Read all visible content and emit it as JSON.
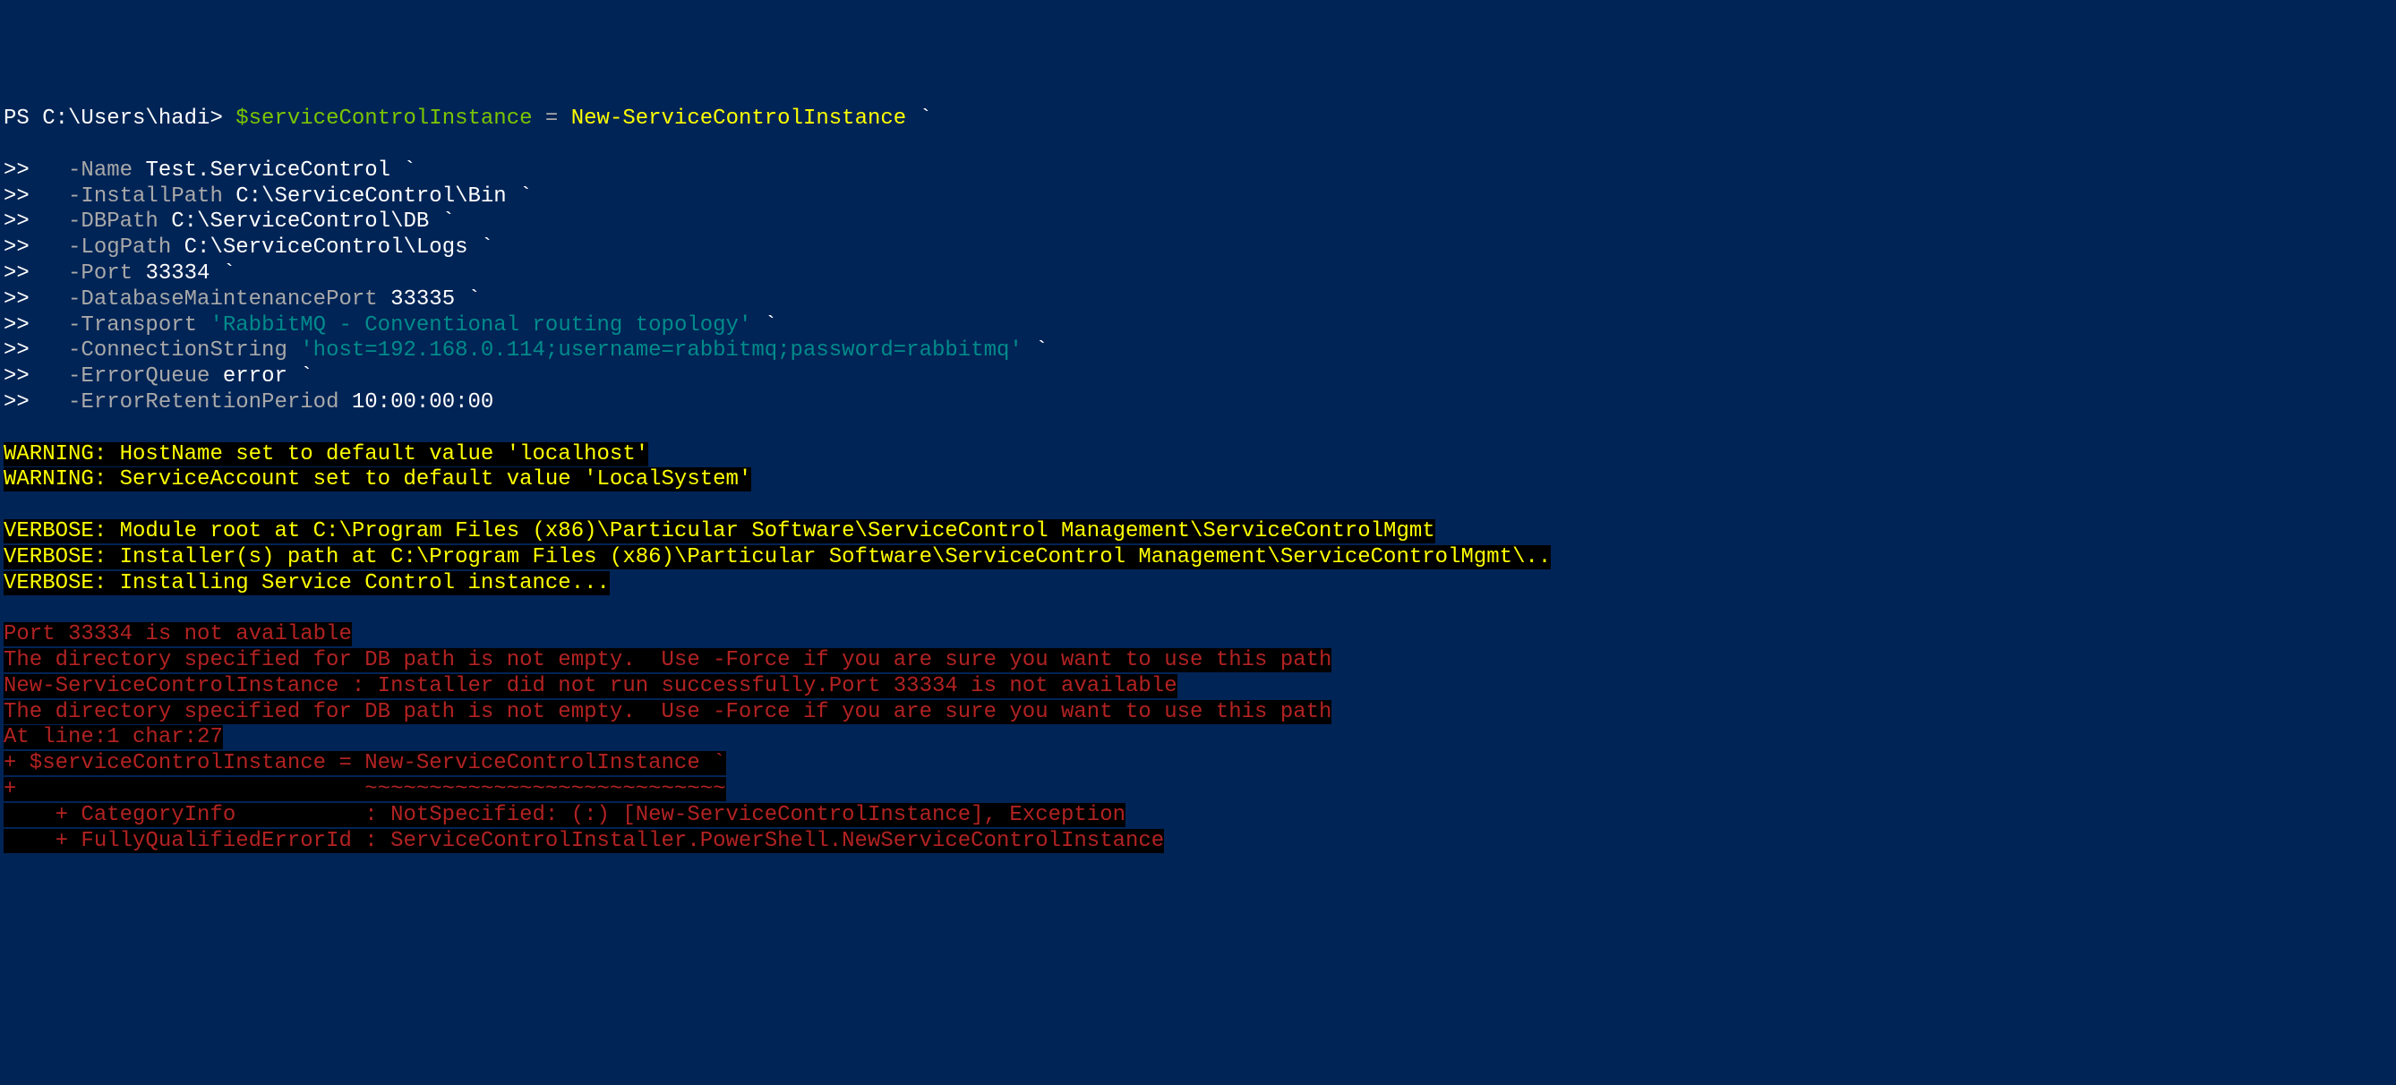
{
  "prompt": {
    "ps": "PS C:\\Users\\hadi> ",
    "var": "$serviceControlInstance",
    "eq": " = ",
    "cmdlet": "New-ServiceControlInstance",
    "backtick": " `",
    "cont": ">>   "
  },
  "params": [
    {
      "name": "-Name",
      "value": "Test.ServiceControl",
      "tail": " `"
    },
    {
      "name": "-InstallPath",
      "value": "C:\\ServiceControl\\Bin",
      "tail": " `"
    },
    {
      "name": "-DBPath",
      "value": "C:\\ServiceControl\\DB",
      "tail": " `"
    },
    {
      "name": "-LogPath",
      "value": "C:\\ServiceControl\\Logs",
      "tail": " `"
    },
    {
      "name": "-Port",
      "value": "33334",
      "tail": " `"
    },
    {
      "name": "-DatabaseMaintenancePort",
      "value": "33335",
      "tail": " `"
    },
    {
      "name": "-Transport",
      "string": "'RabbitMQ - Conventional routing topology'",
      "tail": " `"
    },
    {
      "name": "-ConnectionString",
      "string": "'host=192.168.0.114;username=rabbitmq;password=rabbitmq'",
      "tail": " `"
    },
    {
      "name": "-ErrorQueue",
      "value": "error",
      "tail": " `"
    },
    {
      "name": "-ErrorRetentionPeriod",
      "value": "10:00:00:00",
      "tail": ""
    }
  ],
  "warnings": [
    "WARNING: HostName set to default value 'localhost'",
    "WARNING: ServiceAccount set to default value 'LocalSystem'"
  ],
  "verbose": [
    "VERBOSE: Module root at C:\\Program Files (x86)\\Particular Software\\ServiceControl Management\\ServiceControlMgmt",
    "VERBOSE: Installer(s) path at C:\\Program Files (x86)\\Particular Software\\ServiceControl Management\\ServiceControlMgmt\\..",
    "VERBOSE: Installing Service Control instance..."
  ],
  "errors": [
    "Port 33334 is not available",
    "The directory specified for DB path is not empty.  Use -Force if you are sure you want to use this path",
    "New-ServiceControlInstance : Installer did not run successfully.Port 33334 is not available",
    "The directory specified for DB path is not empty.  Use -Force if you are sure you want to use this path",
    "At line:1 char:27",
    "+ $serviceControlInstance = New-ServiceControlInstance `",
    "+                           ~~~~~~~~~~~~~~~~~~~~~~~~~~~~",
    "    + CategoryInfo          : NotSpecified: (:) [New-ServiceControlInstance], Exception",
    "    + FullyQualifiedErrorId : ServiceControlInstaller.PowerShell.NewServiceControlInstance"
  ]
}
